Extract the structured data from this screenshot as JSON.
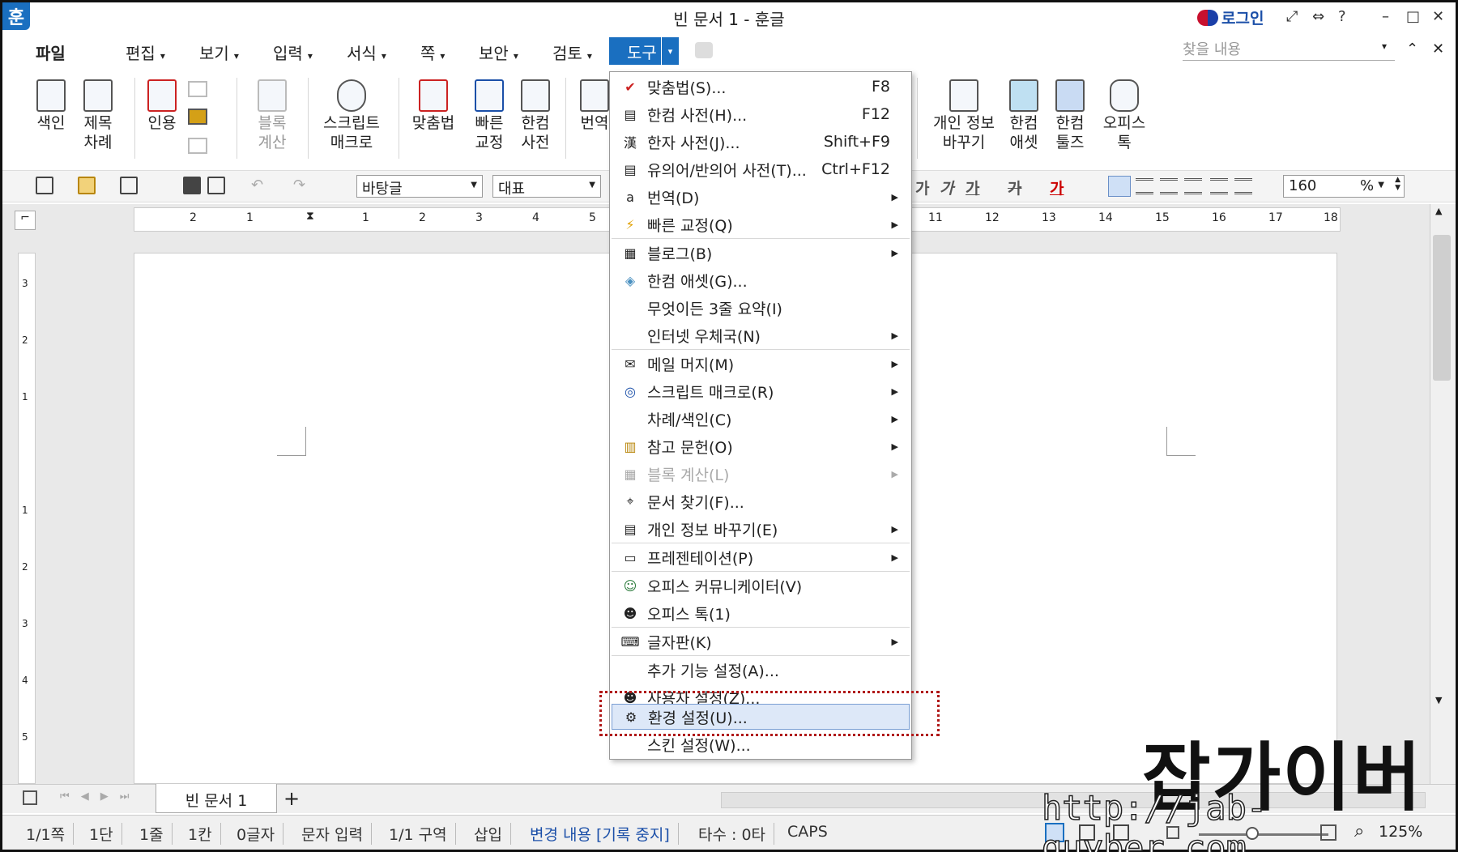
{
  "app": {
    "logo": "훈",
    "title": "빈 문서 1 - 훈글",
    "login": "로그인",
    "window_icons": [
      "⤢",
      "⇔",
      "?",
      "–",
      "□",
      "✕"
    ]
  },
  "menubar": {
    "items": [
      "파일",
      "편집",
      "보기",
      "입력",
      "서식",
      "쪽",
      "보안",
      "검토"
    ],
    "active": "도구",
    "search_placeholder": "찾을 내용"
  },
  "ribbon": [
    {
      "label": "색인"
    },
    {
      "label": "제목\n차례"
    },
    {
      "label": "인용"
    },
    {
      "label": "블록\n계산"
    },
    {
      "label": "스크립트\n매크로"
    },
    {
      "label": "맞춤법"
    },
    {
      "label": "빠른\n교정"
    },
    {
      "label": "한컴\n사전"
    },
    {
      "label": "번역"
    },
    {
      "label": "개인 정보\n바꾸기"
    },
    {
      "label": "한컴\n애셋"
    },
    {
      "label": "한컴\n툴즈"
    },
    {
      "label": "오피스\n톡"
    }
  ],
  "toolbar": {
    "style": "바탕글",
    "font": "대표",
    "zoom": "160",
    "unit": "%",
    "fmt": [
      "가",
      "가",
      "가",
      "가",
      "가"
    ]
  },
  "ruler": {
    "h": [
      "2",
      "1",
      "1",
      "2",
      "3",
      "4",
      "5",
      "11",
      "12",
      "13",
      "14",
      "15",
      "16",
      "17",
      "18"
    ],
    "v": [
      "3",
      "2",
      "1",
      "1",
      "2",
      "3",
      "4",
      "5"
    ]
  },
  "tabs": {
    "doc": "빈 문서 1",
    "add": "+"
  },
  "status": [
    "1/1쪽",
    "1단",
    "1줄",
    "1칸",
    "0글자",
    "문자 입력",
    "1/1 구역",
    "삽입",
    "변경 내용 [기록 중지]",
    "타수 : 0타",
    "CAPS"
  ],
  "zoom_level": "125%",
  "dropdown": [
    {
      "icon": "✔",
      "label": "맞춤법(S)...",
      "shortcut": "F8"
    },
    {
      "icon": "▤",
      "label": "한컴 사전(H)...",
      "shortcut": "F12"
    },
    {
      "icon": "漢",
      "label": "한자 사전(J)...",
      "shortcut": "Shift+F9"
    },
    {
      "icon": "▤",
      "label": "유의어/반의어 사전(T)...",
      "shortcut": "Ctrl+F12"
    },
    {
      "icon": "a",
      "label": "번역(D)",
      "sub": true
    },
    {
      "icon": "⚡",
      "label": "빠른 교정(Q)",
      "sub": true
    },
    {
      "icon": "▦",
      "label": "블로그(B)",
      "sub": true
    },
    {
      "icon": "◈",
      "label": "한컴 애셋(G)..."
    },
    {
      "icon": "",
      "label": "무엇이든 3줄 요약(I)"
    },
    {
      "icon": "",
      "label": "인터넷 우체국(N)",
      "sub": true
    },
    {
      "icon": "✉",
      "label": "메일 머지(M)",
      "sub": true
    },
    {
      "icon": "◎",
      "label": "스크립트 매크로(R)",
      "sub": true
    },
    {
      "icon": "",
      "label": "차례/색인(C)",
      "sub": true
    },
    {
      "icon": "▥",
      "label": "참고 문헌(O)",
      "sub": true
    },
    {
      "icon": "▦",
      "label": "블록 계산(L)",
      "sub": true,
      "disabled": true
    },
    {
      "icon": "⌖",
      "label": "문서 찾기(F)..."
    },
    {
      "icon": "▤",
      "label": "개인 정보 바꾸기(E)",
      "sub": true
    },
    {
      "icon": "▭",
      "label": "프레젠테이션(P)",
      "sub": true
    },
    {
      "icon": "☺",
      "label": "오피스 커뮤니케이터(V)"
    },
    {
      "icon": "☻",
      "label": "오피스 톡(1)"
    },
    {
      "icon": "⌨",
      "label": "글자판(K)",
      "sub": true
    },
    {
      "icon": "",
      "label": "추가 기능 설정(A)..."
    },
    {
      "icon": "☻",
      "label": "사용자 설정(Z)..."
    },
    {
      "icon": "⚙",
      "label": "환경 설정(U)...",
      "highlight": true
    },
    {
      "icon": "",
      "label": "스킨 설정(W)..."
    }
  ],
  "watermark": {
    "title": "잡가이버",
    "url": "http://jab-guyber.com"
  },
  "colors": {
    "accent": "#1a6fc0",
    "highlight_border": "#b01818"
  }
}
